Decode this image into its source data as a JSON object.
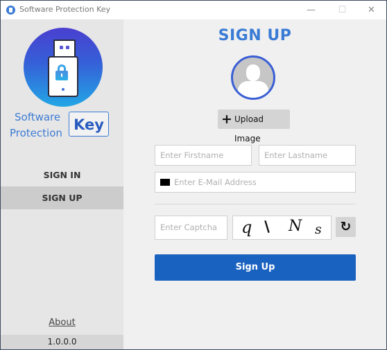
{
  "window": {
    "title": "Software Protection Key",
    "minimize_glyph": "—",
    "maximize_glyph": "☐",
    "close_glyph": "✕"
  },
  "sidebar": {
    "logo": {
      "line1": "Software",
      "line2": "Protection",
      "badge": "Key"
    },
    "nav": [
      {
        "label": "SIGN IN",
        "active": false
      },
      {
        "label": "SIGN UP",
        "active": true
      }
    ],
    "about_label": "About",
    "version": "1.0.0.0"
  },
  "main": {
    "heading": "SIGN UP",
    "upload": {
      "icon": "+",
      "label": "Upload Image"
    },
    "fields": {
      "firstname": {
        "placeholder": "Enter Firstname",
        "value": ""
      },
      "lastname": {
        "placeholder": "Enter Lastname",
        "value": ""
      },
      "email": {
        "placeholder": "Enter E-Mail Address",
        "value": ""
      },
      "captcha": {
        "placeholder": "Enter Captcha",
        "value": ""
      }
    },
    "captcha_chars": [
      "q",
      "\\",
      "N",
      "s"
    ],
    "refresh_glyph": "↻",
    "submit_label": "Sign Up"
  },
  "colors": {
    "accent": "#3a7bd5",
    "button": "#1a62c0",
    "sidebar_bg": "#e6e6e6",
    "active_nav": "#cccccc"
  }
}
